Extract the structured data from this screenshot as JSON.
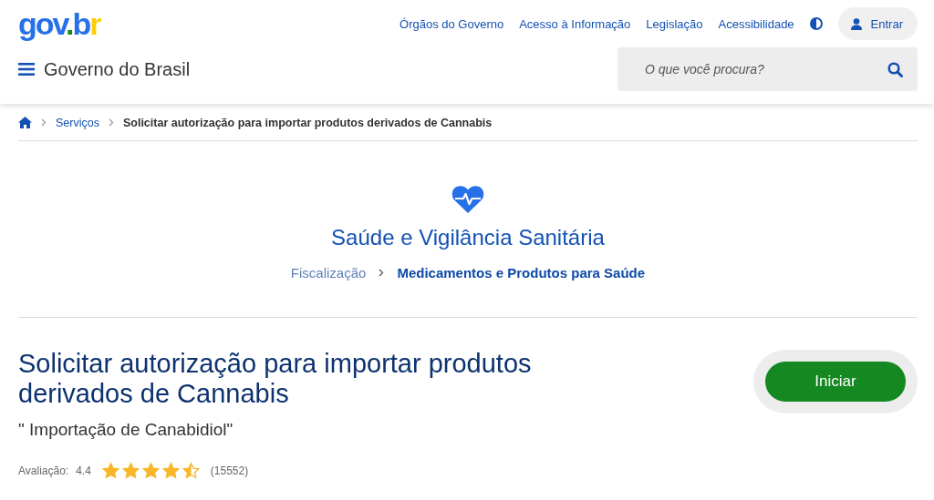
{
  "header": {
    "logo": [
      {
        "text": "g",
        "color": "#2670e8"
      },
      {
        "text": "o",
        "color": "#2670e8"
      },
      {
        "text": "v",
        "color": "#2670e8"
      },
      {
        "text": ".",
        "color": "#168821"
      },
      {
        "text": "b",
        "color": "#2670e8"
      },
      {
        "text": "r",
        "color": "#ffcd07"
      }
    ],
    "links": [
      "Órgãos do Governo",
      "Acesso à Informação",
      "Legislação",
      "Acessibilidade"
    ],
    "login": "Entrar",
    "site_title": "Governo do Brasil",
    "search": {
      "placeholder": "O que você procura?"
    }
  },
  "breadcrumb": [
    "Serviços",
    "Solicitar autorização para importar produtos derivados de Cannabis"
  ],
  "category": {
    "title": "Saúde e Vigilância Sanitária",
    "path": [
      {
        "label": "Fiscalização",
        "current": false
      },
      {
        "label": "Medicamentos e Produtos para Saúde",
        "current": true
      }
    ]
  },
  "service": {
    "title": "Solicitar autorização para importar produtos derivados de Cannabis",
    "subtitle": "\" Importação de Canabidiol\"",
    "rating_label": "Avaliação:",
    "rating": "4.4",
    "stars": 4.5,
    "votes": "(15552)",
    "start_button": "Iniciar"
  }
}
